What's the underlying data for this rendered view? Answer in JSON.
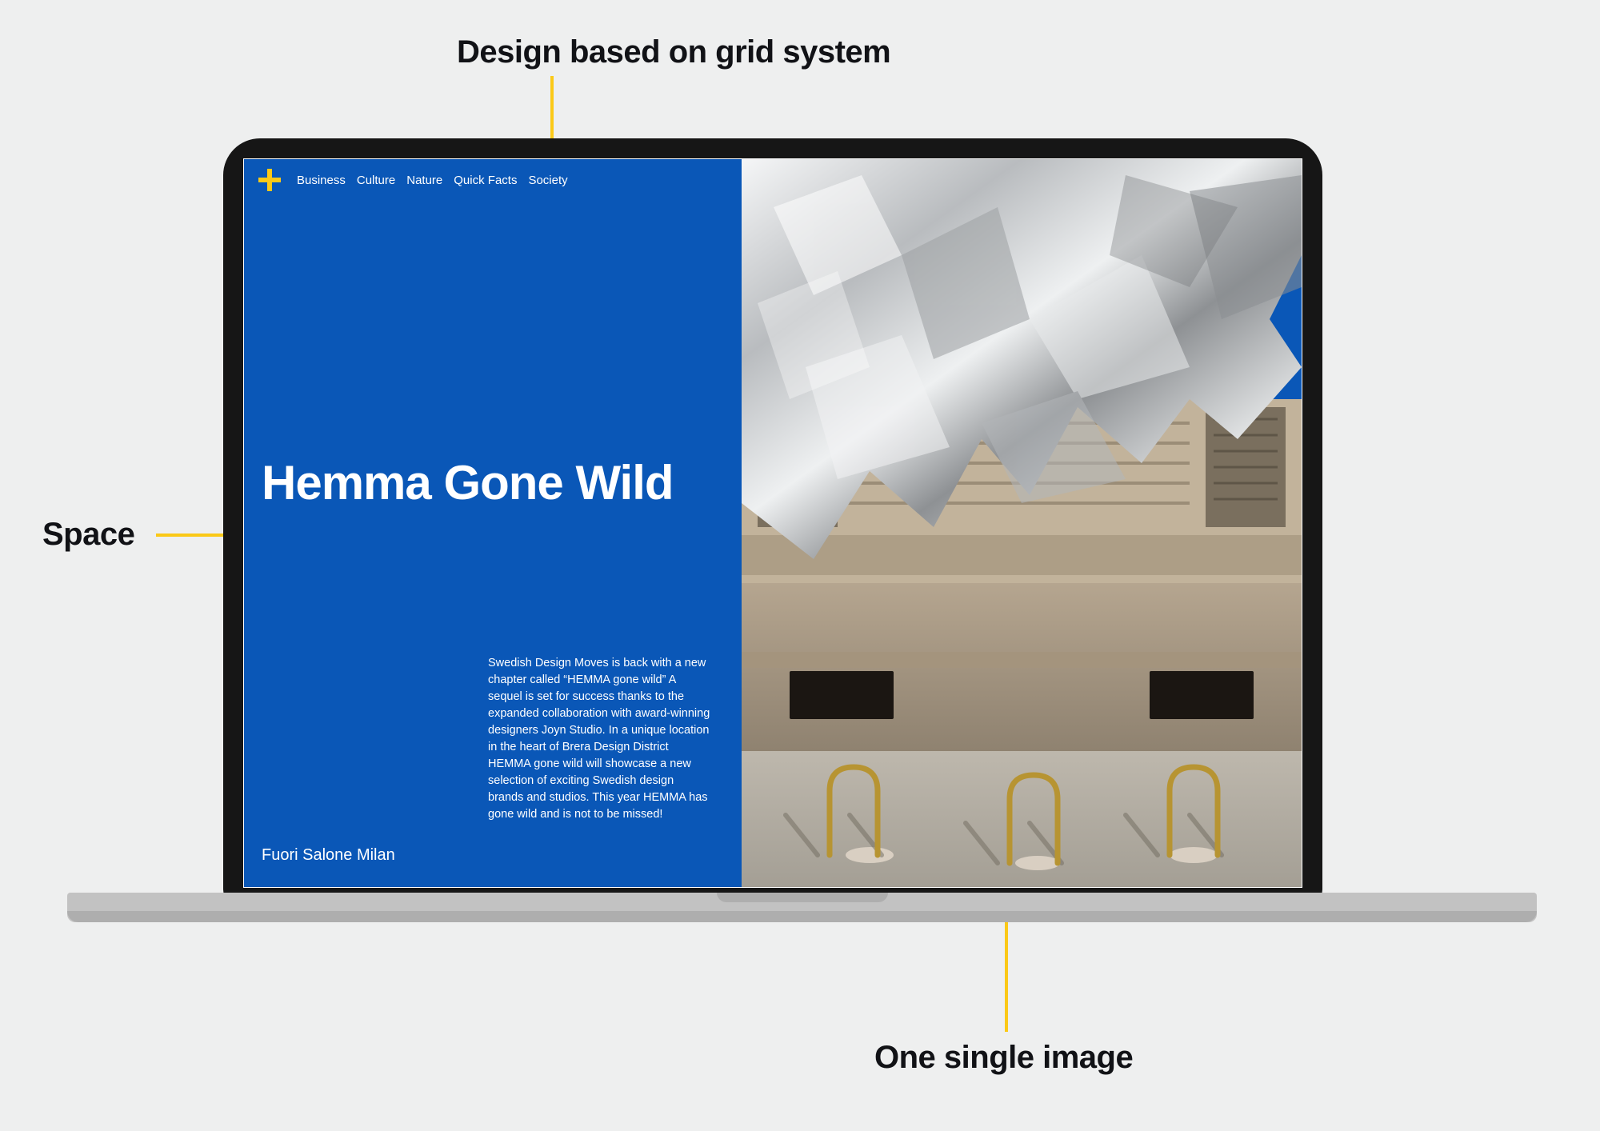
{
  "annotations": {
    "top": "Design based on grid system",
    "left": "Space",
    "bottom": "One single image"
  },
  "nav": {
    "items": [
      "Business",
      "Culture",
      "Nature",
      "Quick Facts",
      "Society"
    ]
  },
  "page": {
    "headline": "Hemma Gone Wild",
    "subtitle": "Fuori Salone Milan",
    "body": "Swedish Design Moves is back with a new chapter called “HEMMA gone wild” A sequel is set for success thanks to the expanded collaboration with award-winning designers Joyn Studio. In a unique location in the heart of Brera Design District HEMMA gone wild will showcase a new selection of exciting Swedish design brands and studios. This year HEMMA has gone wild and is not to be missed!"
  },
  "colors": {
    "blue": "#0a57b7",
    "yellow": "#fbc917",
    "ink": "#111216"
  }
}
